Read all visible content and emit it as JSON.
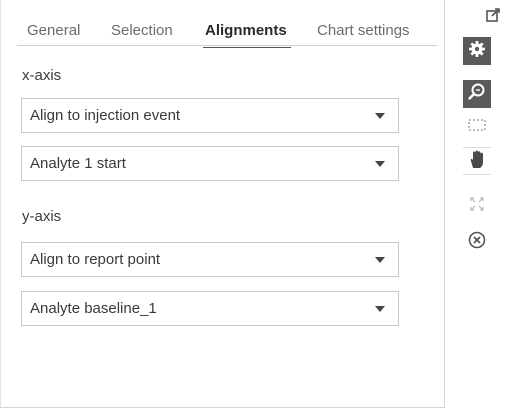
{
  "tabs": [
    {
      "label": "General"
    },
    {
      "label": "Selection"
    },
    {
      "label": "Alignments"
    },
    {
      "label": "Chart settings"
    }
  ],
  "active_tab": "Alignments",
  "x_axis": {
    "label": "x-axis",
    "align_select": "Align to injection event",
    "reference_select": "Analyte 1 start"
  },
  "y_axis": {
    "label": "y-axis",
    "align_select": "Align to report point",
    "reference_select": "Analyte baseline_1"
  },
  "toolbar": {
    "icons": [
      "popout-icon",
      "gear-icon",
      "zoom-icon",
      "selection-rectangle-icon",
      "pan-hand-icon",
      "expand-icon",
      "close-circle-icon"
    ]
  },
  "colors": {
    "dark_button": "#5a5a5a",
    "text": "#3a3a3a"
  }
}
